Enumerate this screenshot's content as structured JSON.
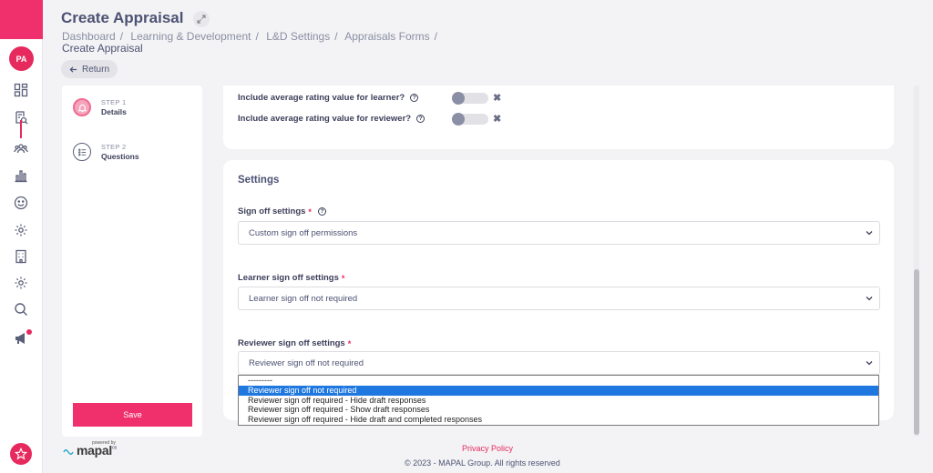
{
  "sidebar": {
    "avatar_initials": "PA",
    "nav_icons": [
      "dashboard-icon",
      "appraisal-search-icon",
      "people-icon",
      "chart-icon",
      "smiley-icon",
      "settings-icon",
      "building-icon",
      "settings-alt-icon",
      "search-icon",
      "megaphone-icon"
    ],
    "accent_color": "#f0306c"
  },
  "header": {
    "title": "Create Appraisal",
    "breadcrumb": [
      "Dashboard",
      "Learning & Development",
      "L&D Settings",
      "Appraisals Forms"
    ],
    "breadcrumb_current": "Create Appraisal",
    "return_label": "Return"
  },
  "steps": [
    {
      "label": "STEP 1",
      "name": "Details",
      "state": "active"
    },
    {
      "label": "STEP 2",
      "name": "Questions",
      "state": "inactive"
    }
  ],
  "save_label": "Save",
  "toggles": [
    {
      "label": "Include average rating value for learner?",
      "value": false
    },
    {
      "label": "Include average rating value for reviewer?",
      "value": false
    }
  ],
  "settings": {
    "heading": "Settings",
    "sign_off": {
      "label": "Sign off settings",
      "value": "Custom sign off permissions"
    },
    "learner_sign_off": {
      "label": "Learner sign off settings",
      "value": "Learner sign off not required"
    },
    "reviewer_sign_off": {
      "label": "Reviewer sign off settings",
      "value": "Reviewer sign off not required",
      "options": [
        "---------",
        "Reviewer sign off not required",
        "Reviewer sign off required - Hide draft responses",
        "Reviewer sign off required - Show draft responses",
        "Reviewer sign off required - Hide draft and completed responses"
      ],
      "selected_index": 1
    }
  },
  "footer": {
    "powered_by": "powered by",
    "logo": "mapal",
    "logo_suffix": "os",
    "privacy": "Privacy Policy",
    "copyright": "© 2023 - MAPAL Group. All rights reserved"
  }
}
